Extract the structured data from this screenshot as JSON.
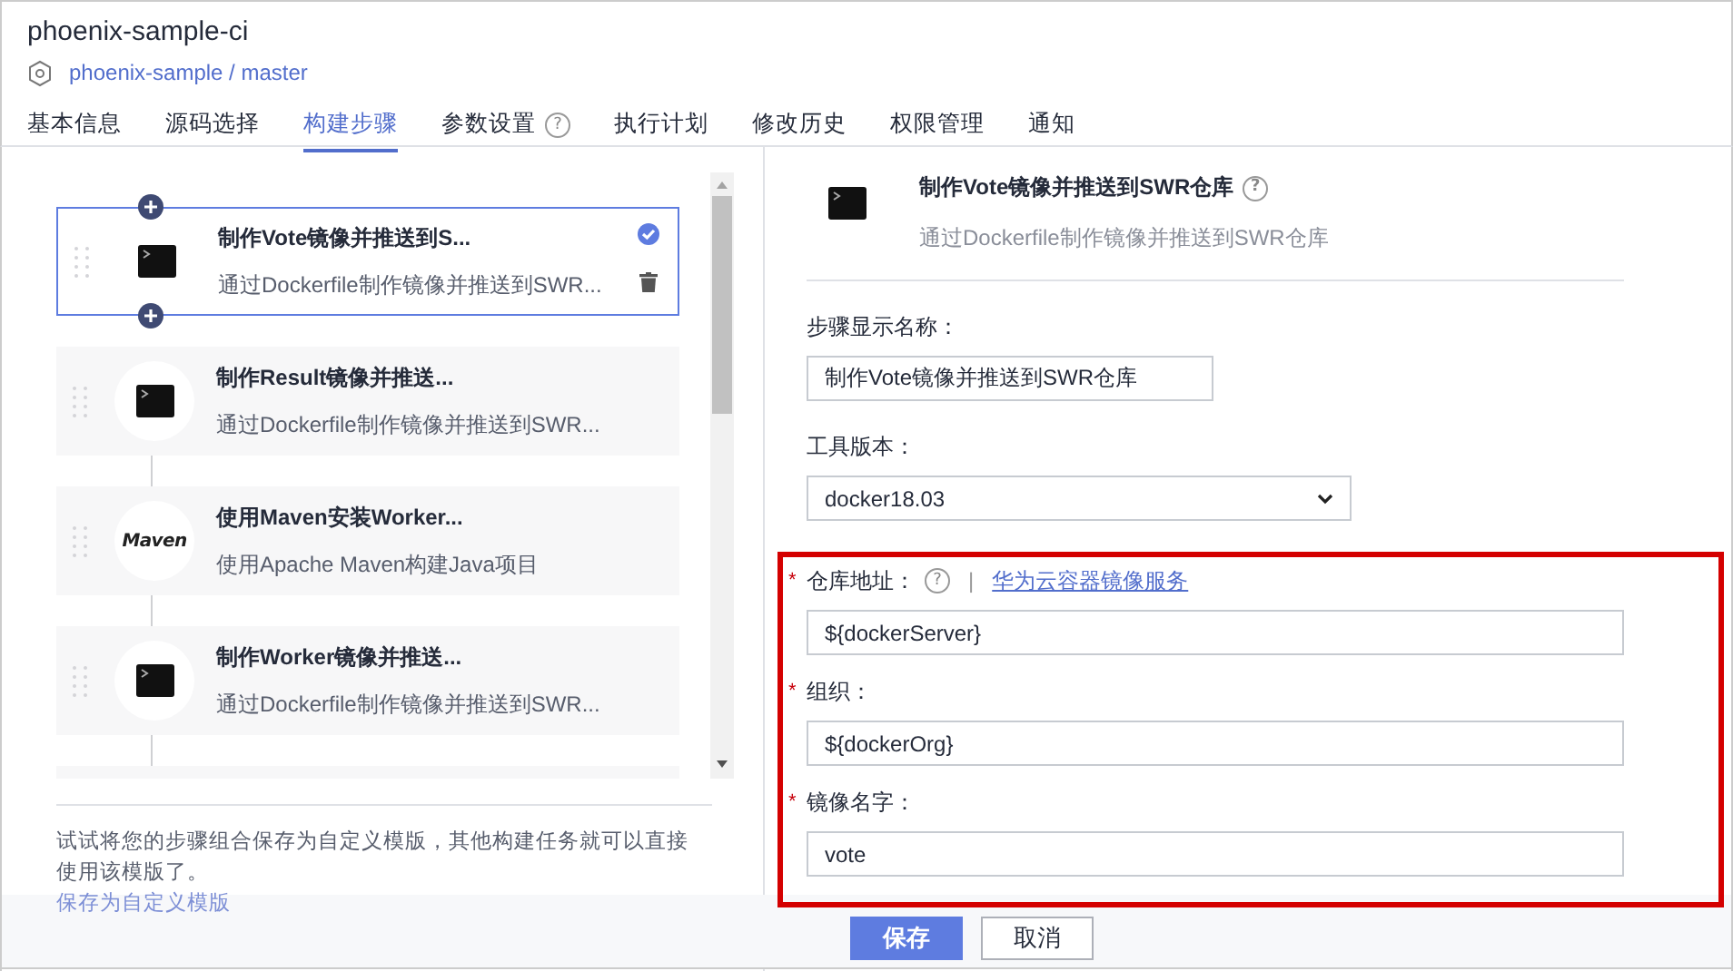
{
  "project": {
    "title": "phoenix-sample-ci",
    "repo": "phoenix-sample / master"
  },
  "tabs": [
    {
      "label": "基本信息",
      "selected": false
    },
    {
      "label": "源码选择",
      "selected": false
    },
    {
      "label": "构建步骤",
      "selected": true
    },
    {
      "label": "参数设置",
      "selected": false,
      "help_icon": "?"
    },
    {
      "label": "执行计划",
      "selected": false
    },
    {
      "label": "修改历史",
      "selected": false
    },
    {
      "label": "权限管理",
      "selected": false
    },
    {
      "label": "通知",
      "selected": false
    }
  ],
  "steps": [
    {
      "kind": "terminal",
      "title": "制作Vote镜像并推送到S...",
      "description": "通过Dockerfile制作镜像并推送到SWR...",
      "selected": true
    },
    {
      "kind": "terminal",
      "title": "制作Result镜像并推送...",
      "description": "通过Dockerfile制作镜像并推送到SWR...",
      "selected": false
    },
    {
      "kind": "maven",
      "logo_text": "Maven",
      "title": "使用Maven安装Worker...",
      "description": "使用Apache Maven构建Java项目",
      "selected": false
    },
    {
      "kind": "terminal",
      "title": "制作Worker镜像并推送...",
      "description": "通过Dockerfile制作镜像并推送到SWR...",
      "selected": false
    },
    {
      "kind": "partial",
      "selected": false
    }
  ],
  "template_hint": {
    "text": "试试将您的步骤组合保存为自定义模版，其他构建任务就可以直接使用该模版了。",
    "link": "保存为自定义模版"
  },
  "detail": {
    "title": "制作Vote镜像并推送到SWR仓库",
    "help_icon": "?",
    "description": "通过Dockerfile制作镜像并推送到SWR仓库",
    "fields": [
      {
        "kind": "text",
        "label": "步骤显示名称：",
        "value": "制作Vote镜像并推送到SWR仓库"
      },
      {
        "kind": "select",
        "label": "工具版本：",
        "value": "docker18.03"
      }
    ],
    "annotated_fields": [
      {
        "kind": "text",
        "required_mark": "*",
        "label": "仓库地址：",
        "help_icon": "?",
        "separator": "|",
        "link": "华为云容器镜像服务",
        "value": "${dockerServer}"
      },
      {
        "kind": "text",
        "required_mark": "*",
        "label": "组织：",
        "value": "${dockerOrg}"
      },
      {
        "kind": "text",
        "required_mark": "*",
        "label": "镜像名字：",
        "value": "vote"
      }
    ]
  },
  "buttons": [
    {
      "kind": "primary",
      "label": "保存"
    },
    {
      "kind": "default",
      "label": "取消"
    }
  ]
}
